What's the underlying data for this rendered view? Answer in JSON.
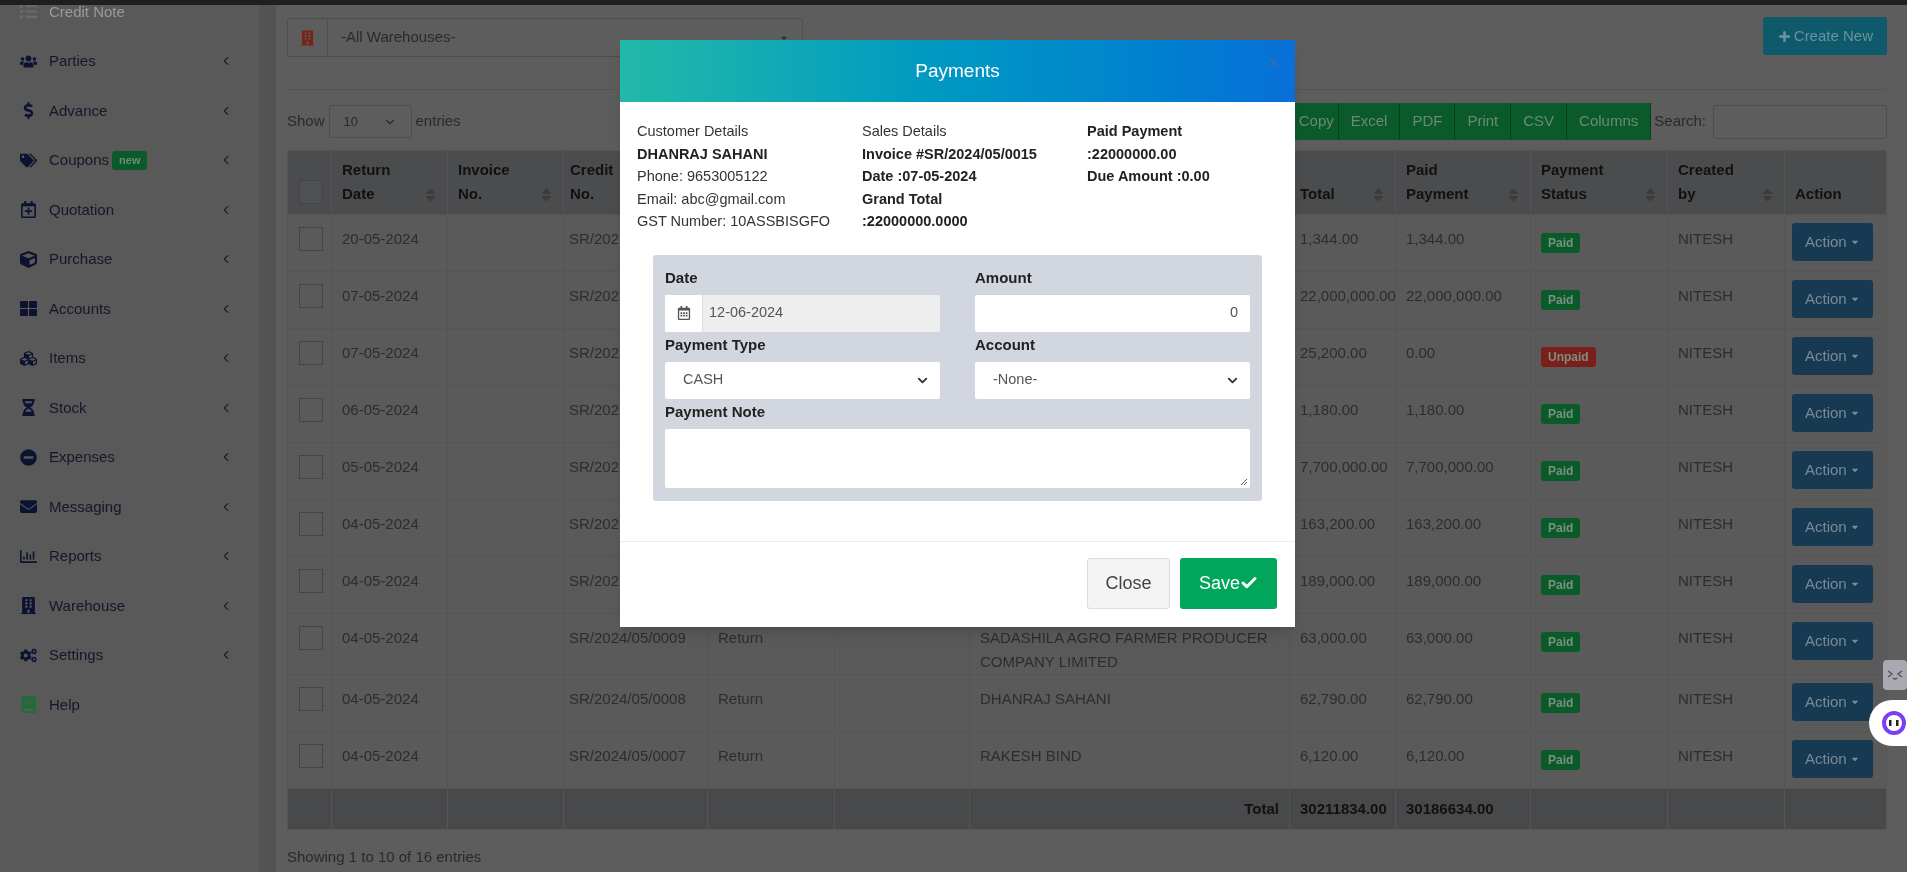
{
  "sidebar": {
    "items": [
      {
        "label": "Credit Note",
        "has_submenu": false
      },
      {
        "label": "Parties",
        "has_submenu": true
      },
      {
        "label": "Advance",
        "has_submenu": true
      },
      {
        "label": "Coupons",
        "badge": "new",
        "has_submenu": true
      },
      {
        "label": "Quotation",
        "has_submenu": true
      },
      {
        "label": "Purchase",
        "has_submenu": true
      },
      {
        "label": "Accounts",
        "has_submenu": true
      },
      {
        "label": "Items",
        "has_submenu": true
      },
      {
        "label": "Stock",
        "has_submenu": true
      },
      {
        "label": "Expenses",
        "has_submenu": true
      },
      {
        "label": "Messaging",
        "has_submenu": true
      },
      {
        "label": "Reports",
        "has_submenu": true
      },
      {
        "label": "Warehouse",
        "has_submenu": true
      },
      {
        "label": "Settings",
        "has_submenu": true
      },
      {
        "label": "Help",
        "has_submenu": false
      }
    ]
  },
  "toolbar": {
    "warehouse_select": "-All Warehouses-",
    "create_button": "Create New"
  },
  "table_controls": {
    "show_label": "Show",
    "page_size": "10",
    "entries_label": "entries",
    "export_buttons": [
      "Copy",
      "Excel",
      "PDF",
      "Print",
      "CSV",
      "Columns"
    ],
    "search_label": "Search:"
  },
  "table": {
    "header_checked": false,
    "columns": [
      {
        "label": "Return Date",
        "sortable": true
      },
      {
        "label": "Invoice No.",
        "sortable": true
      },
      {
        "label": "Credit No.",
        "sortable": false
      },
      {
        "label": "Total",
        "sortable": true
      },
      {
        "label": "Paid Payment",
        "sortable": true
      },
      {
        "label": "Payment Status",
        "sortable": true
      },
      {
        "label": "Created by",
        "sortable": true
      },
      {
        "label": "Action",
        "sortable": false
      }
    ],
    "rows": [
      {
        "checked": false,
        "return_date": "20-05-2024",
        "credit_no": "SR/202",
        "total": "1,344.00",
        "paid": "1,344.00",
        "status": {
          "label": "Paid",
          "color": "#0b5a2a"
        },
        "created_by": "NITESH",
        "action": "Action"
      },
      {
        "checked": false,
        "return_date": "07-05-2024",
        "credit_no": "SR/202",
        "total": "22,000,000.00",
        "paid": "22,000,000.00",
        "status": {
          "label": "Paid",
          "color": "#0b5a2a"
        },
        "created_by": "NITESH",
        "action": "Action"
      },
      {
        "checked": false,
        "return_date": "07-05-2024",
        "credit_no": "SR/202",
        "total": "25,200.00",
        "paid": "0.00",
        "status": {
          "label": "Unpaid",
          "color": "#7a1f1a"
        },
        "created_by": "NITESH",
        "action": "Action"
      },
      {
        "checked": false,
        "return_date": "06-05-2024",
        "credit_no": "SR/202",
        "total": "1,180.00",
        "paid": "1,180.00",
        "status": {
          "label": "Paid",
          "color": "#0b5a2a"
        },
        "created_by": "NITESH",
        "action": "Action"
      },
      {
        "checked": false,
        "return_date": "05-05-2024",
        "credit_no": "SR/202",
        "total": "7,700,000.00",
        "paid": "7,700,000.00",
        "status": {
          "label": "Paid",
          "color": "#0b5a2a"
        },
        "created_by": "NITESH",
        "action": "Action"
      },
      {
        "checked": false,
        "return_date": "04-05-2024",
        "credit_no": "SR/202",
        "total": "163,200.00",
        "paid": "163,200.00",
        "status": {
          "label": "Paid",
          "color": "#0b5a2a"
        },
        "created_by": "NITESH",
        "action": "Action"
      },
      {
        "checked": false,
        "return_date": "04-05-2024",
        "credit_no": "SR/202",
        "total": "189,000.00",
        "paid": "189,000.00",
        "status": {
          "label": "Paid",
          "color": "#0b5a2a"
        },
        "created_by": "NITESH",
        "action": "Action"
      },
      {
        "checked": false,
        "return_date": "04-05-2024",
        "credit_no": "SR/2024/05/0009",
        "type": "Return",
        "customer": "SADASHILA AGRO FARMER PRODUCER COMPANY LIMITED",
        "total": "63,000.00",
        "paid": "63,000.00",
        "status": {
          "label": "Paid",
          "color": "#0b5a2a"
        },
        "created_by": "NITESH",
        "action": "Action"
      },
      {
        "checked": false,
        "return_date": "04-05-2024",
        "credit_no": "SR/2024/05/0008",
        "type": "Return",
        "customer": "DHANRAJ SAHANI",
        "total": "62,790.00",
        "paid": "62,790.00",
        "status": {
          "label": "Paid",
          "color": "#0b5a2a"
        },
        "created_by": "NITESH",
        "action": "Action"
      },
      {
        "checked": false,
        "return_date": "04-05-2024",
        "credit_no": "SR/2024/05/0007",
        "type": "Return",
        "customer": "RAKESH BIND",
        "total": "6,120.00",
        "paid": "6,120.00",
        "status": {
          "label": "Paid",
          "color": "#0b5a2a"
        },
        "created_by": "NITESH",
        "action": "Action"
      }
    ],
    "footer": {
      "label": "Total",
      "total": "30211834.00",
      "paid": "30186634.00"
    },
    "info": "Showing 1 to 10 of 16 entries"
  },
  "modal": {
    "title": "Payments",
    "customer": {
      "heading": "Customer Details",
      "name": "DHANRAJ SAHANI",
      "phone": "Phone: 9653005122",
      "email": "Email: abc@gmail.com",
      "gst": "GST Number: 10ASSBISGFO"
    },
    "sales": {
      "heading": "Sales Details",
      "invoice": "Invoice #SR/2024/05/0015",
      "date": "Date :07-05-2024",
      "grand_total_label": "Grand Total",
      "grand_total": ":22000000.0000"
    },
    "payment": {
      "paid_label": "Paid Payment",
      "paid_value": ":22000000.00",
      "due": "Due Amount :0.00"
    },
    "form": {
      "date_label": "Date",
      "date_value": "12-06-2024",
      "amount_label": "Amount",
      "amount_value": "0",
      "type_label": "Payment Type",
      "type_value": "CASH",
      "account_label": "Account",
      "account_value": "-None-",
      "note_label": "Payment Note"
    },
    "buttons": {
      "close": "Close",
      "save": "Save"
    }
  }
}
